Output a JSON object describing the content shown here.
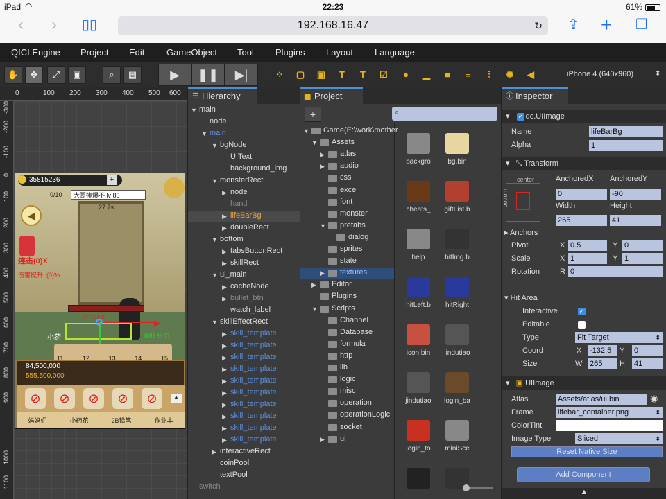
{
  "status": {
    "carrier": "iPad",
    "time": "22:23",
    "battery": "61%"
  },
  "safari": {
    "url": "192.168.16.47"
  },
  "menu": [
    "QICI Engine",
    "Project",
    "Edit",
    "GameObject",
    "Tool",
    "Plugins",
    "Layout",
    "Language"
  ],
  "toolbar": {
    "device": "iPhone 4 (640x960)"
  },
  "scene": {
    "ruler_x": [
      "0",
      "100",
      "200",
      "300",
      "400",
      "500",
      "600"
    ],
    "ruler_y": [
      "-300",
      "-200",
      "-100",
      "0",
      "100",
      "200",
      "300",
      "400",
      "500",
      "600",
      "700",
      "800",
      "900",
      "1000",
      "1100"
    ],
    "game": {
      "coins": "35815236",
      "count": "0/10",
      "title": "大哥揍爆不 lv 80",
      "timer": "27.7s",
      "line1": "连击(0)X",
      "line2": "伤害提升: (0)%",
      "hp": "STS HP",
      "hint": "(889 张-7)",
      "label": "小药",
      "score1": "84,500,000",
      "score2": "555,500,000",
      "skills": [
        "11",
        "12",
        "13",
        "14",
        "15"
      ],
      "buttons": [
        "妈妈们",
        "小药花",
        "2B铅笔",
        "作业本"
      ]
    }
  },
  "hierarchy": {
    "title": "Hierarchy",
    "items": [
      {
        "label": "main",
        "depth": 0,
        "arrow": "open",
        "color": "normal"
      },
      {
        "label": "node",
        "depth": 1,
        "arrow": "none",
        "color": "normal"
      },
      {
        "label": "main",
        "depth": 1,
        "arrow": "open",
        "color": "blue"
      },
      {
        "label": "bgNode",
        "depth": 2,
        "arrow": "open",
        "color": "normal"
      },
      {
        "label": "UIText",
        "depth": 3,
        "arrow": "none",
        "color": "normal"
      },
      {
        "label": "background_img",
        "depth": 3,
        "arrow": "none",
        "color": "normal"
      },
      {
        "label": "monsterRect",
        "depth": 2,
        "arrow": "open",
        "color": "normal"
      },
      {
        "label": "node",
        "depth": 3,
        "arrow": "closed",
        "color": "normal"
      },
      {
        "label": "hand",
        "depth": 3,
        "arrow": "none",
        "color": "gray"
      },
      {
        "label": "lifeBarBg",
        "depth": 3,
        "arrow": "closed",
        "color": "orange",
        "selected": true
      },
      {
        "label": "doubleRect",
        "depth": 3,
        "arrow": "closed",
        "color": "normal"
      },
      {
        "label": "bottom",
        "depth": 2,
        "arrow": "open",
        "color": "normal"
      },
      {
        "label": "tabsButtonRect",
        "depth": 3,
        "arrow": "closed",
        "color": "normal"
      },
      {
        "label": "skillRect",
        "depth": 3,
        "arrow": "closed",
        "color": "normal"
      },
      {
        "label": "ui_main",
        "depth": 2,
        "arrow": "open",
        "color": "normal"
      },
      {
        "label": "cacheNode",
        "depth": 3,
        "arrow": "closed",
        "color": "normal"
      },
      {
        "label": "bullet_btn",
        "depth": 3,
        "arrow": "closed",
        "color": "gray"
      },
      {
        "label": "watch_label",
        "depth": 3,
        "arrow": "none",
        "color": "normal"
      },
      {
        "label": "skillEffectRect",
        "depth": 2,
        "arrow": "open",
        "color": "normal"
      },
      {
        "label": "skill_template",
        "depth": 3,
        "arrow": "closed",
        "color": "blue"
      },
      {
        "label": "skill_template",
        "depth": 3,
        "arrow": "closed",
        "color": "blue"
      },
      {
        "label": "skill_template",
        "depth": 3,
        "arrow": "closed",
        "color": "blue"
      },
      {
        "label": "skill_template",
        "depth": 3,
        "arrow": "closed",
        "color": "blue"
      },
      {
        "label": "skill_template",
        "depth": 3,
        "arrow": "closed",
        "color": "blue"
      },
      {
        "label": "skill_template",
        "depth": 3,
        "arrow": "closed",
        "color": "blue"
      },
      {
        "label": "skill_template",
        "depth": 3,
        "arrow": "closed",
        "color": "blue"
      },
      {
        "label": "skill_template",
        "depth": 3,
        "arrow": "closed",
        "color": "blue"
      },
      {
        "label": "skill_template",
        "depth": 3,
        "arrow": "closed",
        "color": "blue"
      },
      {
        "label": "skill_template",
        "depth": 3,
        "arrow": "closed",
        "color": "blue"
      },
      {
        "label": "interactiveRect",
        "depth": 2,
        "arrow": "closed",
        "color": "normal"
      },
      {
        "label": "coinPool",
        "depth": 2,
        "arrow": "none",
        "color": "normal"
      },
      {
        "label": "textPool",
        "depth": 2,
        "arrow": "none",
        "color": "normal"
      },
      {
        "label": "switch",
        "depth": 0,
        "arrow": "none",
        "color": "gray"
      }
    ]
  },
  "project": {
    "title": "Project",
    "add": "+",
    "tree": [
      {
        "label": "Game(E:\\work\\mother",
        "depth": 0,
        "arrow": "open"
      },
      {
        "label": "Assets",
        "depth": 1,
        "arrow": "open"
      },
      {
        "label": "atlas",
        "depth": 2,
        "arrow": "closed"
      },
      {
        "label": "audio",
        "depth": 2,
        "arrow": "closed"
      },
      {
        "label": "css",
        "depth": 2,
        "arrow": "none"
      },
      {
        "label": "excel",
        "depth": 2,
        "arrow": "none"
      },
      {
        "label": "font",
        "depth": 2,
        "arrow": "none"
      },
      {
        "label": "monster",
        "depth": 2,
        "arrow": "none"
      },
      {
        "label": "prefabs",
        "depth": 2,
        "arrow": "open"
      },
      {
        "label": "dialog",
        "depth": 3,
        "arrow": "none"
      },
      {
        "label": "sprites",
        "depth": 2,
        "arrow": "none"
      },
      {
        "label": "state",
        "depth": 2,
        "arrow": "none"
      },
      {
        "label": "textures",
        "depth": 2,
        "arrow": "closed",
        "selected": true
      },
      {
        "label": "Editor",
        "depth": 1,
        "arrow": "closed"
      },
      {
        "label": "Plugins",
        "depth": 1,
        "arrow": "none"
      },
      {
        "label": "Scripts",
        "depth": 1,
        "arrow": "open"
      },
      {
        "label": "Channel",
        "depth": 2,
        "arrow": "none"
      },
      {
        "label": "Database",
        "depth": 2,
        "arrow": "none"
      },
      {
        "label": "formula",
        "depth": 2,
        "arrow": "none"
      },
      {
        "label": "http",
        "depth": 2,
        "arrow": "none"
      },
      {
        "label": "lib",
        "depth": 2,
        "arrow": "none"
      },
      {
        "label": "logic",
        "depth": 2,
        "arrow": "none"
      },
      {
        "label": "misc",
        "depth": 2,
        "arrow": "none"
      },
      {
        "label": "operation",
        "depth": 2,
        "arrow": "none"
      },
      {
        "label": "operationLogic",
        "depth": 2,
        "arrow": "none"
      },
      {
        "label": "socket",
        "depth": 2,
        "arrow": "none"
      },
      {
        "label": "ui",
        "depth": 2,
        "arrow": "closed"
      }
    ],
    "files": [
      "backgro",
      "bg.bin",
      "cheats_",
      "giftList.b",
      "help",
      "hitImg.b",
      "hitLeft.b",
      "hitRight",
      "icon.bin",
      "jindutiao",
      "jindutiao",
      "login_ba",
      "login_to",
      "miniSce",
      "",
      ""
    ]
  },
  "inspector": {
    "title": "Inspector",
    "uiimage_header": "qc.UIImage",
    "name_label": "Name",
    "name": "lifeBarBg",
    "alpha_label": "Alpha",
    "alpha": "1",
    "transform": "Transform",
    "center": "center",
    "bottom": "bottom",
    "anchored_x_label": "AnchoredX",
    "anchored_y_label": "AnchoredY",
    "anchored_x": "0",
    "anchored_y": "-90",
    "width_label": "Width",
    "height_label": "Height",
    "width": "265",
    "height": "41",
    "anchors": "Anchors",
    "pivot_label": "Pivot",
    "pivot_x": "0.5",
    "pivot_y": "0",
    "scale_label": "Scale",
    "scale_x": "1",
    "scale_y": "1",
    "rotation_label": "Rotation",
    "rotation": "0",
    "x": "X",
    "y": "Y",
    "r": "R",
    "w": "W",
    "h": "H",
    "hit_area": "Hit Area",
    "interactive_label": "Interactive",
    "editable_label": "Editable",
    "type_label": "Type",
    "type": "Fit Target",
    "coord_label": "Coord",
    "coord_x": "-132.5",
    "coord_y": "0",
    "size_label": "Size",
    "size_w": "265",
    "size_h": "41",
    "ui_image": "UIImage",
    "atlas_label": "Atlas",
    "atlas": "Assets/atlas/ui.bin",
    "frame_label": "Frame",
    "frame": "lifebar_container.png",
    "colortint_label": "ColorTint",
    "imagetype_label": "Image Type",
    "imagetype": "Sliced",
    "reset": "Reset Native Size",
    "add": "Add Component"
  }
}
